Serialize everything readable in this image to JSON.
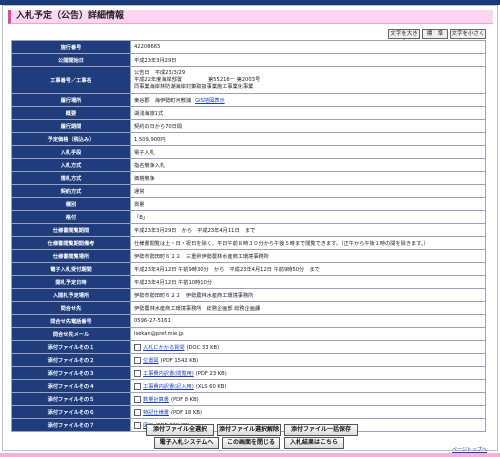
{
  "page": {
    "title": "入札予定（公告）詳細情報"
  },
  "font_controls": {
    "larger": "文字を大きく",
    "standard": "標　準",
    "smaller": "文字を小さく"
  },
  "details": [
    {
      "key": "施行番号",
      "value": "42208665"
    },
    {
      "key": "公開開始日",
      "value": "平成23年3月29日"
    },
    {
      "key": "工事番号／工事名",
      "lines": [
        "公告日　平成23/3/29",
        "平成22年度海岸部置　　　　　第55216一 第2003号",
        "同事業海岸林防潮海岸対策取扱事業施工事業化事業"
      ]
    },
    {
      "key": "履行場所",
      "value": "東谷郡　海伊勢町河敷浦",
      "link": "GIS地図表示"
    },
    {
      "key": "概要",
      "value": "湖浅海旅1式"
    },
    {
      "key": "履行期間",
      "value": "契約の日から70日間"
    },
    {
      "key": "予定価格（税込み）",
      "value": "1,509,900円"
    },
    {
      "key": "入札手段",
      "value": "電子入札"
    },
    {
      "key": "入札方式",
      "value": "指名競争入札"
    },
    {
      "key": "落札方式",
      "value": "価格競争"
    },
    {
      "key": "契約方式",
      "value": "通常"
    },
    {
      "key": "種別",
      "value": "測量"
    },
    {
      "key": "格付",
      "value": "「B」"
    },
    {
      "key": "仕様書閲覧期間",
      "value": "平成23年3月29日　から　平成23年4月11日　まで"
    },
    {
      "key": "仕様書閲覧期間備考",
      "value": "仕様書閲覧は土・日・祝日を除く、平日午前８時３０分から午後５時まで閲覧できます。（正午から午後１時の間を除きます。）"
    },
    {
      "key": "仕様書閲覧場所",
      "value": "伊勢市勢田町６２２　三重県伊勢農林水産商工環境事務所"
    },
    {
      "key": "電子入札受付期間",
      "value": "平成23年4月12日 午前9時30分　から　平成23年4月12日 午前9時50分　まで"
    },
    {
      "key": "開札予定日時",
      "value": "平成23年4月12日 午前10時10分"
    },
    {
      "key": "入開札予定場所",
      "value": "伊勢市勢田町６２２　伊勢農林水産商工環境事務所"
    },
    {
      "key": "問合せ先",
      "value": "伊勢農林水産商工環境事務所　総務企画部 総務企画課"
    },
    {
      "key": "問合せ先電話番号",
      "value": "0596-27-5161"
    },
    {
      "key": "問合せ先メール",
      "value": "isekan@pref.mie.jp"
    },
    {
      "key": "添付ファイルその１",
      "file": "入札にかかる質問",
      "meta": "(DOC 33 KB)"
    },
    {
      "key": "添付ファイルその２",
      "file": "位置図",
      "meta": "(PDF 1542 KB)"
    },
    {
      "key": "添付ファイルその３",
      "file": "工事費内訳書(閲覧用)",
      "meta": "(PDF 23 KB)"
    },
    {
      "key": "添付ファイルその４",
      "file": "工事費内訳書(記入用)",
      "meta": "(XLS 60 KB)"
    },
    {
      "key": "添付ファイルその５",
      "file": "数量計算書",
      "meta": "(PDF 8 KB)"
    },
    {
      "key": "添付ファイルその６",
      "file": "特記仕様書",
      "meta": "(PDF 18 KB)"
    },
    {
      "key": "添付ファイルその７",
      "file": "図面",
      "meta": "(PDF 620 KB)"
    }
  ],
  "buttons": {
    "select_all": "添付ファイル全選択",
    "deselect_all": "添付ファイル選択解除",
    "save_all": "添付ファイル一括保存",
    "e_bid": "電子入札システムへ",
    "close": "この画面を閉じる",
    "results": "入札結果はこちら"
  },
  "page_top": "ページトップへ",
  "colors": {
    "header_cell": "#1f3d7d",
    "title_bg": "#ffd6f2",
    "accent": "#e0479e",
    "link": "#1a3fbf"
  }
}
